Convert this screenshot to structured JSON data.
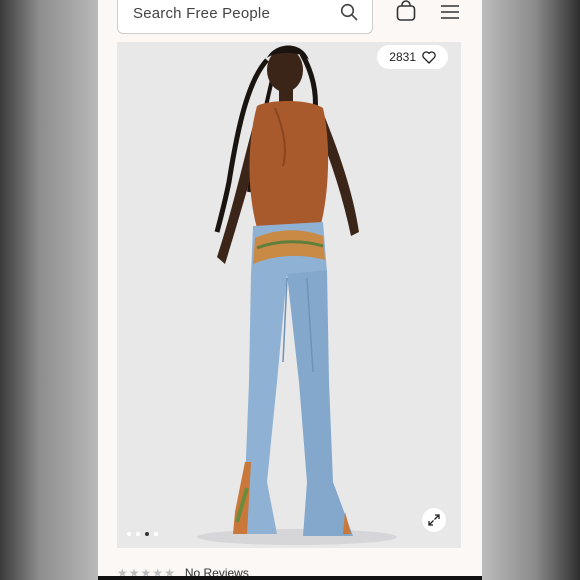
{
  "header": {
    "search_placeholder": "Search Free People",
    "search_icon": "search-icon",
    "bag_icon": "shopping-bag-icon",
    "menu_icon": "hamburger-menu-icon"
  },
  "product": {
    "like_count": "2831",
    "heart_icon": "heart-icon",
    "carousel": {
      "total": 4,
      "active_index": 2
    },
    "expand_icon": "expand-icon",
    "colors": {
      "vest": "#a85a2c",
      "denim": "#8fb2d4",
      "background": "#e8e8e9"
    }
  },
  "reviews": {
    "rating": 0,
    "stars_max": 5,
    "label": "No Reviews"
  }
}
